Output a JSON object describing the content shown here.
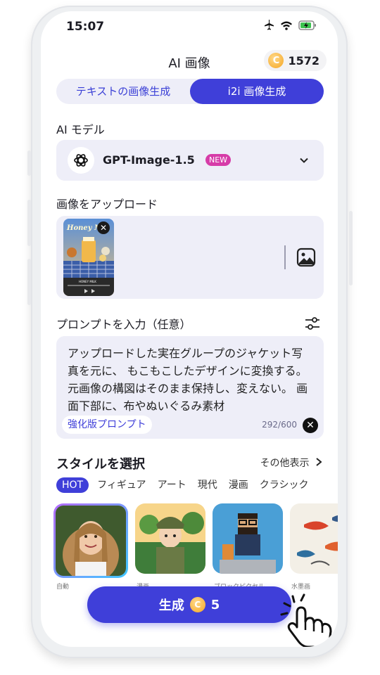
{
  "status": {
    "time": "15:07"
  },
  "header": {
    "title": "AI 画像",
    "coin_symbol": "C",
    "coin_balance": "1572"
  },
  "tabs": [
    {
      "label": "テキストの画像生成",
      "active": false
    },
    {
      "label": "i2i 画像生成",
      "active": true
    }
  ],
  "model": {
    "section_label": "AI モデル",
    "name": "GPT-Image-1.5",
    "badge": "NEW"
  },
  "upload": {
    "section_label": "画像をアップロード",
    "thumb_title": "Honey M",
    "thumb_subtitle": "HONEY MILK"
  },
  "prompt": {
    "section_label": "プロンプトを入力（任意）",
    "text": "アップロードした実在グループのジャケット写真を元に、 もこもこしたデザインに変換する。 元画像の構図はそのまま保持し、変えない。 画面下部に、布やぬいぐるみ素材",
    "enhance_label": "強化版プロンプト",
    "counter": "292/600"
  },
  "styles": {
    "section_label": "スタイルを選択",
    "more_label": "その他表示",
    "chips": [
      "HOT",
      "フィギュア",
      "アート",
      "現代",
      "漫画",
      "クラシック"
    ],
    "cards": [
      {
        "label": "自動",
        "selected": true
      },
      {
        "label": "漫画",
        "selected": false
      },
      {
        "label": "ブロックピクセル",
        "selected": false
      },
      {
        "label": "水墨画",
        "selected": false
      }
    ]
  },
  "generate": {
    "label": "生成",
    "cost": "5"
  },
  "colors": {
    "accent": "#3f3fd9",
    "panel": "#eeeef8",
    "badge": "#d63ca8",
    "coin": "#f5a623"
  }
}
